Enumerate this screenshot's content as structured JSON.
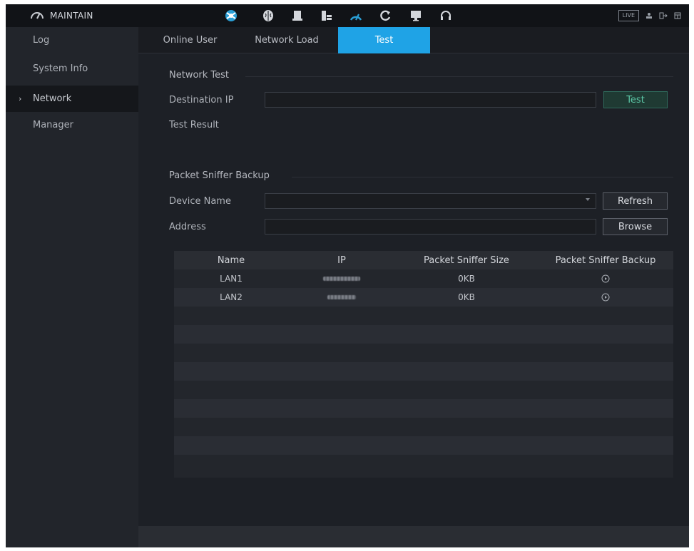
{
  "app": {
    "title": "MAINTAIN",
    "top_icons": [
      "network-globe-icon",
      "brain-icon",
      "record-icon",
      "storage-icon",
      "maintain-gauge-icon",
      "refresh-icon",
      "monitor-icon",
      "headset-icon"
    ],
    "live_label": "LIVE",
    "accent_color": "#1fa3e6"
  },
  "sidebar": {
    "items": [
      {
        "label": "Log"
      },
      {
        "label": "System Info"
      },
      {
        "label": "Network"
      },
      {
        "label": "Manager"
      }
    ],
    "active_index": 2
  },
  "tabs": [
    {
      "label": "Online User"
    },
    {
      "label": "Network Load"
    },
    {
      "label": "Test"
    }
  ],
  "network_test": {
    "section_title": "Network Test",
    "destination_ip_label": "Destination IP",
    "destination_ip_value": "",
    "test_button": "Test",
    "test_result_label": "Test Result"
  },
  "packet_sniffer": {
    "section_title": "Packet Sniffer Backup",
    "device_name_label": "Device Name",
    "device_name_value": "",
    "refresh_button": "Refresh",
    "address_label": "Address",
    "address_value": "",
    "browse_button": "Browse"
  },
  "table": {
    "columns": [
      "Name",
      "IP",
      "Packet Sniffer Size",
      "Packet Sniffer Backup"
    ],
    "rows": [
      {
        "name": "LAN1",
        "size": "0KB"
      },
      {
        "name": "LAN2",
        "size": "0KB"
      }
    ]
  }
}
